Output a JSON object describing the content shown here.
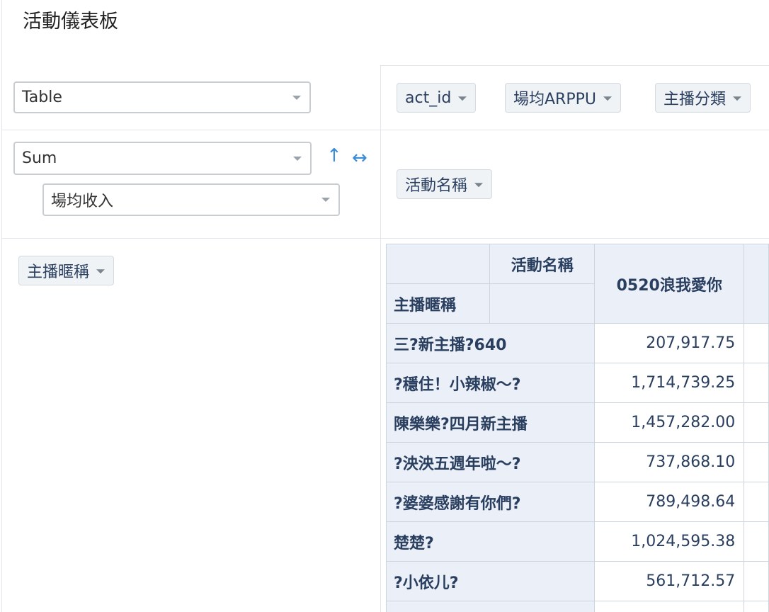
{
  "page": {
    "title": "活動儀表板"
  },
  "controls": {
    "renderer": "Table",
    "aggregator": "Sum",
    "value_field": "場均收入",
    "sort_symbol": "↑",
    "swap_symbol": "↔"
  },
  "fields": {
    "unused": [
      "act_id",
      "場均ARPPU",
      "主播分類"
    ],
    "cols": [
      "活動名稱"
    ],
    "rows": [
      "主播暱稱"
    ]
  },
  "table": {
    "col_axis_label": "活動名稱",
    "row_axis_label": "主播暱稱",
    "columns": [
      "0520浪我愛你"
    ],
    "rows": [
      {
        "name": "三?新主播?640",
        "value": "207,917.75"
      },
      {
        "name": "?穩住！小辣椒～?",
        "value": "1,714,739.25"
      },
      {
        "name": "陳樂樂?四月新主播",
        "value": "1,457,282.00"
      },
      {
        "name": "?泱泱五週年啦～?",
        "value": "737,868.10"
      },
      {
        "name": "?婆婆感謝有你們?",
        "value": "789,498.64"
      },
      {
        "name": "楚楚?",
        "value": "1,024,595.38"
      },
      {
        "name": "?小依儿?",
        "value": "561,712.57"
      }
    ]
  }
}
